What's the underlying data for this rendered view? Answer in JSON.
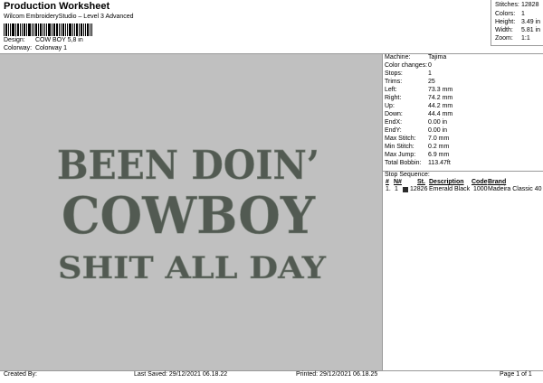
{
  "header": {
    "title": "Production Worksheet",
    "software": "Wilcom EmbroideryStudio – Level 3 Advanced",
    "design_label": "Design:",
    "design_value": "COW BOY  5,8 in",
    "colorway_label": "Colorway:",
    "colorway_value": "Colorway 1"
  },
  "summary": {
    "stitches_label": "Stitches:",
    "stitches_value": "12828",
    "colors_label": "Colors:",
    "colors_value": "1",
    "height_label": "Height:",
    "height_value": "3.49 in",
    "width_label": "Width:",
    "width_value": "5.81 in",
    "zoom_label": "Zoom:",
    "zoom_value": "1:1"
  },
  "design_text": {
    "line1": "BEEN DOIN’",
    "line2": "COWBOY",
    "line3": "SHIT ALL DAY"
  },
  "info": [
    {
      "label": "Machine:",
      "value": "Tajima"
    },
    {
      "label": "Color changes:",
      "value": "0"
    },
    {
      "label": "Stops:",
      "value": "1"
    },
    {
      "label": "Trims:",
      "value": "25"
    },
    {
      "label": "Left:",
      "value": "73.3 mm"
    },
    {
      "label": "Right:",
      "value": "74.2 mm"
    },
    {
      "label": "Up:",
      "value": "44.2 mm"
    },
    {
      "label": "Down:",
      "value": "44.4 mm"
    },
    {
      "label": "EndX:",
      "value": "0.00 in"
    },
    {
      "label": "EndY:",
      "value": "0.00 in"
    },
    {
      "label": "Max Stitch:",
      "value": "7.0 mm"
    },
    {
      "label": "Min Stitch:",
      "value": "0.2 mm"
    },
    {
      "label": "Max Jump:",
      "value": "6.9 mm"
    },
    {
      "label": "Total Bobbin:",
      "value": "113.47ft"
    }
  ],
  "stop_sequence": {
    "label": "Stop Sequence:",
    "columns": [
      "#",
      "N#",
      "St.",
      "Description",
      "Code",
      "Brand"
    ],
    "rows": [
      {
        "num": "1.",
        "n": "1",
        "stitches": "12826",
        "description": "Emerald Black",
        "code": "1000",
        "brand": "Madeira Classic 40",
        "color": "#2b2b2b"
      }
    ]
  },
  "footer": {
    "created_by": "Created By:",
    "last_saved": "Last Saved: 29/12/2021 06.18.22",
    "printed": "Printed: 29/12/2021 06.18.25",
    "page": "Page 1 of 1"
  }
}
